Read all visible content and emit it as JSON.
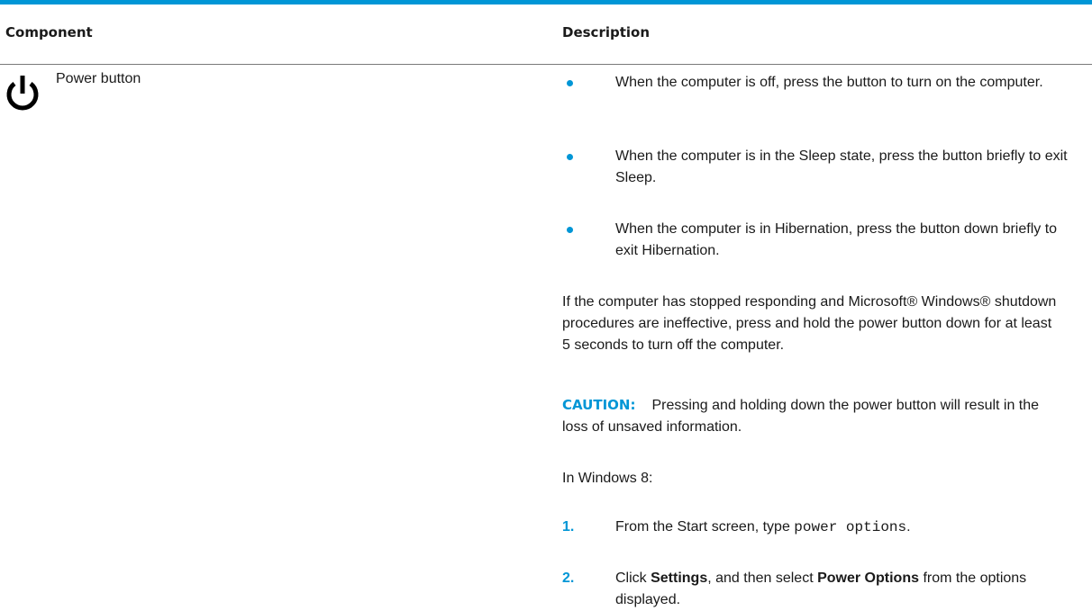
{
  "table": {
    "header": {
      "component": "Component",
      "description": "Description"
    },
    "row": {
      "icon": "power-icon",
      "component": "Power button",
      "bullets": [
        "When the computer is off, press the button to turn on the computer.",
        "When the computer is in the Sleep state, press the button briefly to exit Sleep.",
        "When the computer is in Hibernation, press the button down briefly to exit Hibernation."
      ],
      "paragraph": "If the computer has stopped responding and Microsoft® Windows® shutdown procedures are ineffective, press and hold the power button down for at least 5 seconds to turn off the computer.",
      "caution_label": "CAUTION:",
      "caution_text": "Pressing and holding down the power button will result in the loss of unsaved information.",
      "windows_heading": "In Windows 8:",
      "steps": [
        {
          "num": "1.",
          "pre": "From the Start screen, type ",
          "code": "power options",
          "post": "."
        },
        {
          "num": "2.",
          "pre": "Click ",
          "bold1": "Settings",
          "mid": ", and then select ",
          "bold2": "Power Options",
          "post": " from the options displayed."
        }
      ]
    }
  },
  "colors": {
    "accent": "#0096d6",
    "text": "#1a1a1a"
  }
}
